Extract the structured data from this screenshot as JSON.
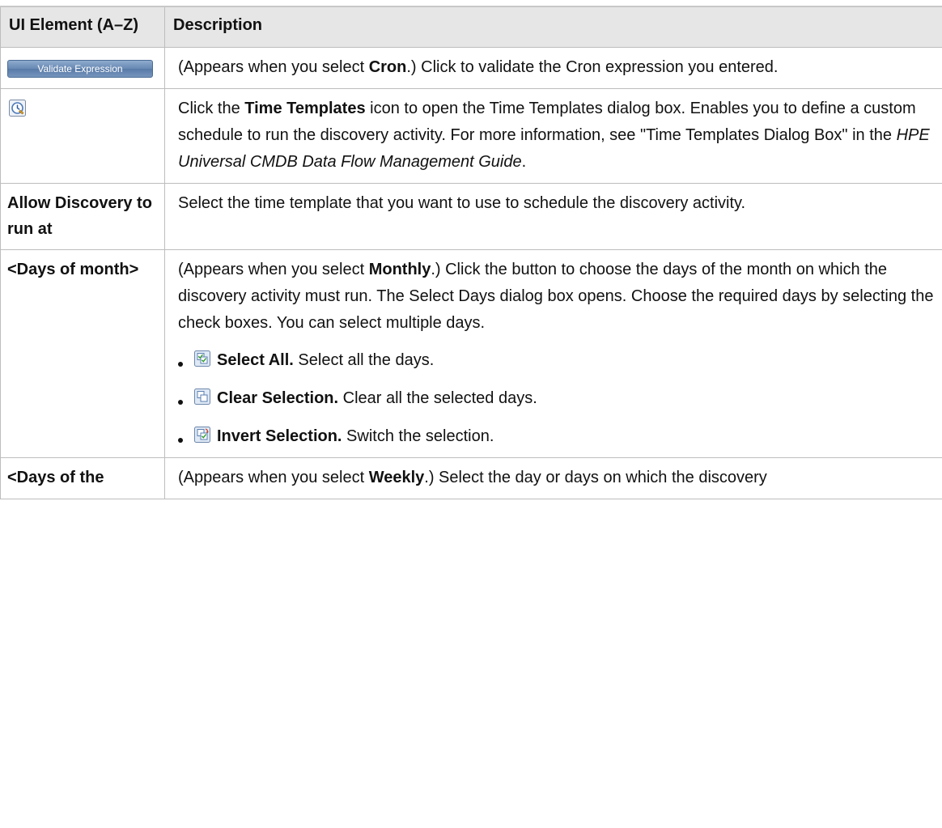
{
  "table": {
    "header": {
      "col1": "UI Element (A–Z)",
      "col2": "Description"
    },
    "rows": [
      {
        "button_label": "Validate Expression",
        "desc": {
          "t1": "(Appears when you select ",
          "b1": "Cron",
          "t2": ".) Click to validate the Cron expression you entered."
        }
      },
      {
        "icon": "time-templates-icon",
        "desc": {
          "t1": "Click the ",
          "b1": "Time Templates",
          "t2": " icon to open the Time Templates dialog box. Enables you to define a custom schedule to run the discovery activity. For more information, see \"Time Templates Dialog Box\" in the ",
          "i1": "HPE Universal CMDB Data Flow Management Guide",
          "t3": "."
        }
      },
      {
        "label": "Allow Discovery to run at",
        "desc": {
          "t1": "Select the time template that you want to use to schedule the discovery activity."
        }
      },
      {
        "label": "<Days of month>",
        "desc": {
          "t1": "(Appears when you select ",
          "b1": "Monthly",
          "t2": ".) Click the button to choose the days of the month on which the discovery activity must run. The Select Days dialog box opens. Choose the required days by selecting the check boxes. You can select multiple days."
        },
        "bullets": [
          {
            "icon": "select-all-icon",
            "title": "Select All.",
            "text": " Select all the days."
          },
          {
            "icon": "clear-selection-icon",
            "title": "Clear Selection.",
            "text": " Clear all the selected days."
          },
          {
            "icon": "invert-selection-icon",
            "title": "Invert Selection.",
            "text": " Switch the selection."
          }
        ]
      },
      {
        "label": "<Days of the",
        "desc": {
          "t1": "(Appears when you select ",
          "b1": "Weekly",
          "t2": ".) Select the day or days on which the discovery"
        }
      }
    ]
  }
}
